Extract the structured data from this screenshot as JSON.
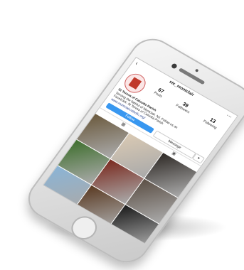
{
  "profile": {
    "username": "stc_montclair",
    "stats": [
      {
        "value": "67",
        "label": "Posts"
      },
      {
        "value": "39",
        "label": "Followers"
      },
      {
        "value": "13",
        "label": "Following"
      }
    ],
    "bio_name": "St Teresa of Calcutta Parish",
    "bio_lines": [
      "Serving the faithful of Montclair, NJ. Follow us on",
      "Facebook: St Teresa of Calcutta Parish"
    ],
    "bio_link": "www.montclaircatholic.org/"
  },
  "actions": {
    "follow": "Follow",
    "message": "Message"
  },
  "icons": {
    "back": "back-chevron-icon",
    "more": "more-dots-icon",
    "grid": "grid-icon",
    "tagged": "tagged-icon"
  },
  "grid_colors": [
    "#6b5a3e",
    "#d9c9b3",
    "#2f2a26",
    "#3f6f2e",
    "#7a2a1f",
    "#5c5046",
    "#8ab4d6",
    "#5a3a22",
    "#1b1b1b",
    "#3a3f7a",
    "#1e1a18",
    "#d04a6a"
  ]
}
